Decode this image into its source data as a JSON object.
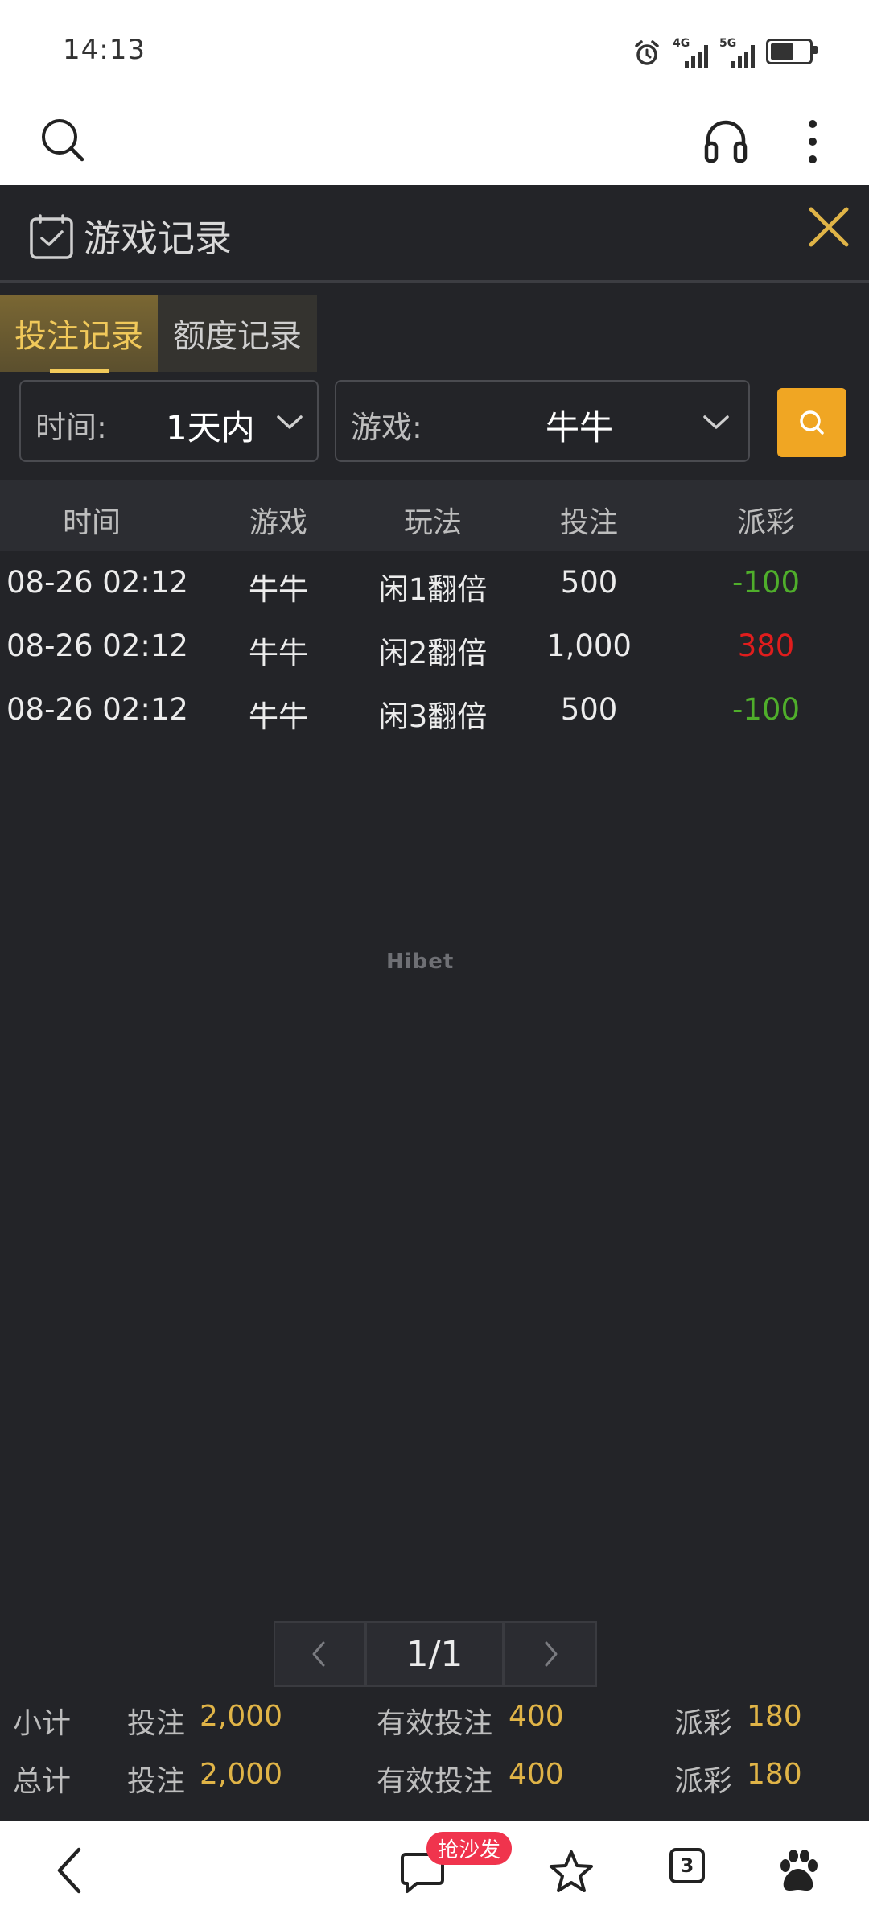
{
  "status": {
    "time": "14:13",
    "net1": "4G",
    "net2": "5G",
    "battery_level": 0.7
  },
  "icons": {
    "search": "search-icon",
    "headset": "headset-icon",
    "menu": "more-vertical-icon",
    "close": "close-icon"
  },
  "header": {
    "title": "游戏记录"
  },
  "tabs": [
    {
      "label": "投注记录",
      "active": true
    },
    {
      "label": "额度记录",
      "active": false
    }
  ],
  "filters": {
    "time": {
      "label": "时间:",
      "value": "1天内"
    },
    "game": {
      "label": "游戏:",
      "value": "牛牛"
    }
  },
  "table": {
    "headers": [
      "时间",
      "游戏",
      "玩法",
      "投注",
      "派彩"
    ],
    "rows": [
      {
        "time": "08-26 02:12",
        "game": "牛牛",
        "play": "闲1翻倍",
        "bet": "500",
        "payout": "-100",
        "payout_sign": "negative"
      },
      {
        "time": "08-26 02:12",
        "game": "牛牛",
        "play": "闲2翻倍",
        "bet": "1,000",
        "payout": "380",
        "payout_sign": "positive"
      },
      {
        "time": "08-26 02:12",
        "game": "牛牛",
        "play": "闲3翻倍",
        "bet": "500",
        "payout": "-100",
        "payout_sign": "negative"
      }
    ]
  },
  "watermark": "Hibet",
  "pager": {
    "page": "1/1"
  },
  "summary": {
    "subtotal": {
      "label": "小计",
      "bet_label": "投注",
      "bet": "2,000",
      "valid_label": "有效投注",
      "valid": "400",
      "payout_label": "派彩",
      "payout": "180"
    },
    "total": {
      "label": "总计",
      "bet_label": "投注",
      "bet": "2,000",
      "valid_label": "有效投注",
      "valid": "400",
      "payout_label": "派彩",
      "payout": "180"
    }
  },
  "bottombar": {
    "badge": "抢沙发",
    "tab_count": "3"
  },
  "colors": {
    "accent": "#f1c95a",
    "search_button": "#f0a623",
    "negative": "#4fae2b",
    "positive": "#e01d1d"
  }
}
